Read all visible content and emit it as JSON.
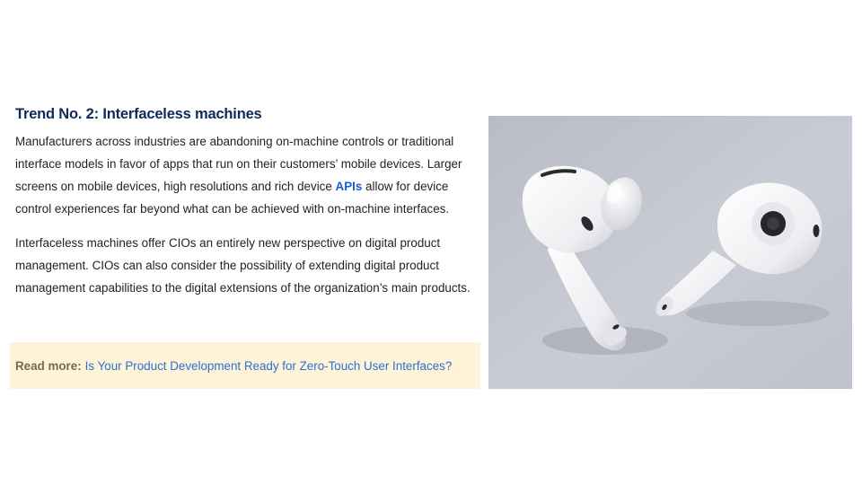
{
  "article": {
    "heading": "Trend No. 2: Interfaceless machines",
    "p1_before_link": "Manufacturers across industries are abandoning on-machine controls or traditional interface models in favor of apps that run on their customers’ mobile devices. Larger screens on mobile devices, high resolutions and rich device ",
    "p1_link": "APIs",
    "p1_after_link": " allow for device control experiences far beyond what can be achieved with on-machine interfaces.",
    "p2": "Interfaceless machines offer CIOs an entirely new perspective on digital product management. CIOs can also consider the possibility of extending digital product management capabilities to the digital extensions of the organization’s main products."
  },
  "read_more": {
    "label": "Read more:",
    "link_text": "Is Your Product Development Ready for Zero-Touch User Interfaces?"
  },
  "colors": {
    "heading": "#0d2a5a",
    "link": "#1a5fc8",
    "callout_bg": "#fdf3d8"
  }
}
